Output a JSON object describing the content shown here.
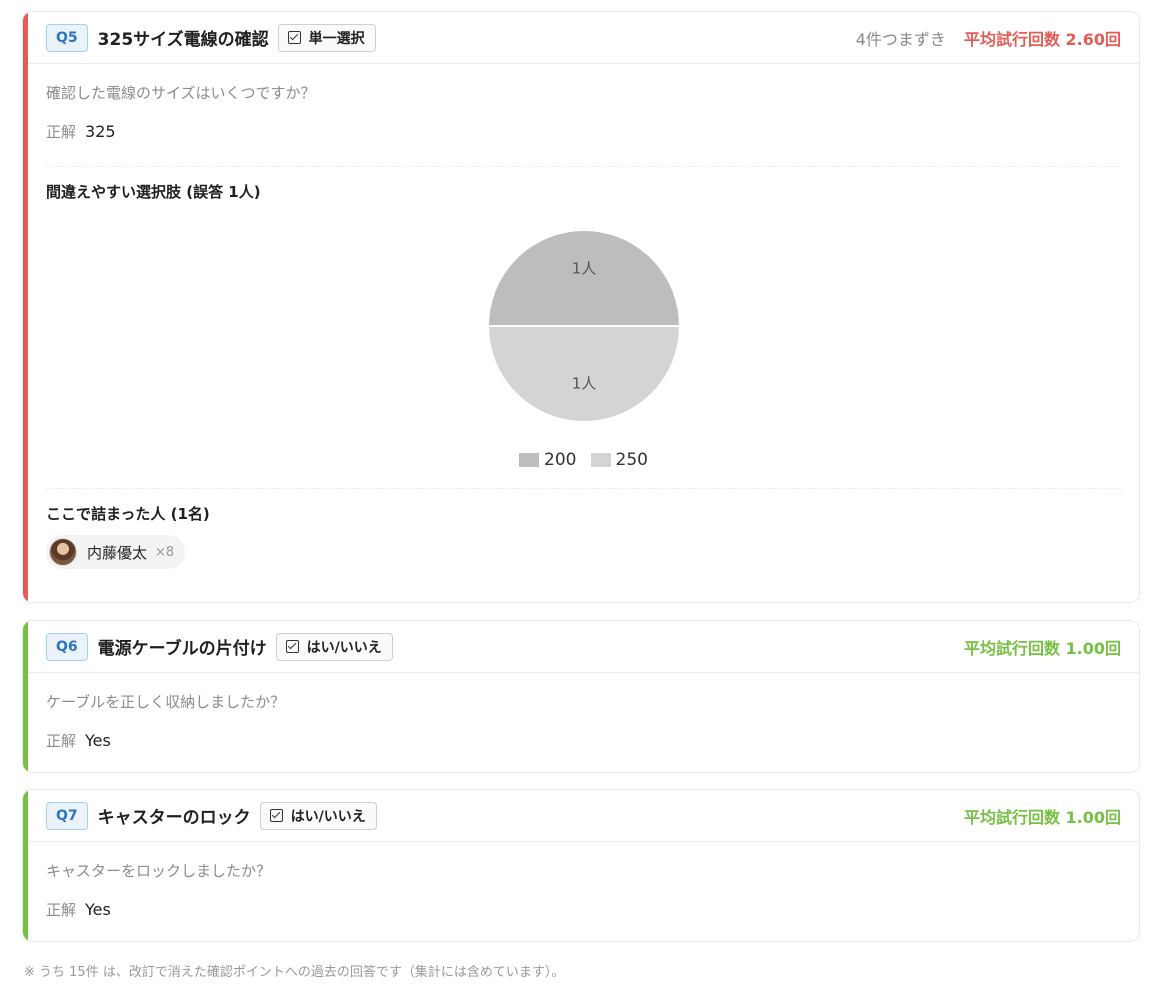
{
  "questions": [
    {
      "number": "Q5",
      "title": "325サイズ電線の確認",
      "type_label": "単一選択",
      "stumble_label": "4件つまずき",
      "avg_label": "平均試行回数 2.60回",
      "status_color": "#e35d57",
      "question_text": "確認した電線のサイズはいくつですか？",
      "answer_label": "正解",
      "answer_value": "325",
      "mistakes_title": "間違えやすい選択肢 (誤答 1人)",
      "stuck_title": "ここで詰まった人 (1名)",
      "stuck_people": [
        {
          "name": "内藤優太",
          "count": "×8"
        }
      ]
    },
    {
      "number": "Q6",
      "title": "電源ケーブルの片付け",
      "type_label": "はい/いいえ",
      "avg_label": "平均試行回数 1.00回",
      "status_color": "#76c043",
      "question_text": "ケーブルを正しく収納しましたか？",
      "answer_label": "正解",
      "answer_value": "Yes"
    },
    {
      "number": "Q7",
      "title": "キャスターのロック",
      "type_label": "はい/いいえ",
      "avg_label": "平均試行回数 1.00回",
      "status_color": "#76c043",
      "question_text": "キャスターをロックしましたか？",
      "answer_label": "正解",
      "answer_value": "Yes"
    }
  ],
  "chart_data": {
    "type": "pie",
    "categories": [
      "200",
      "250"
    ],
    "values": [
      1,
      1
    ],
    "slice_labels": [
      "1人",
      "1人"
    ],
    "colors": [
      "#bdbdbd",
      "#d4d4d4"
    ],
    "legend_position": "bottom"
  },
  "footnote": "※ うち 15件 は、改訂で消えた確認ポイントへの過去の回答です（集計には含めています）。"
}
